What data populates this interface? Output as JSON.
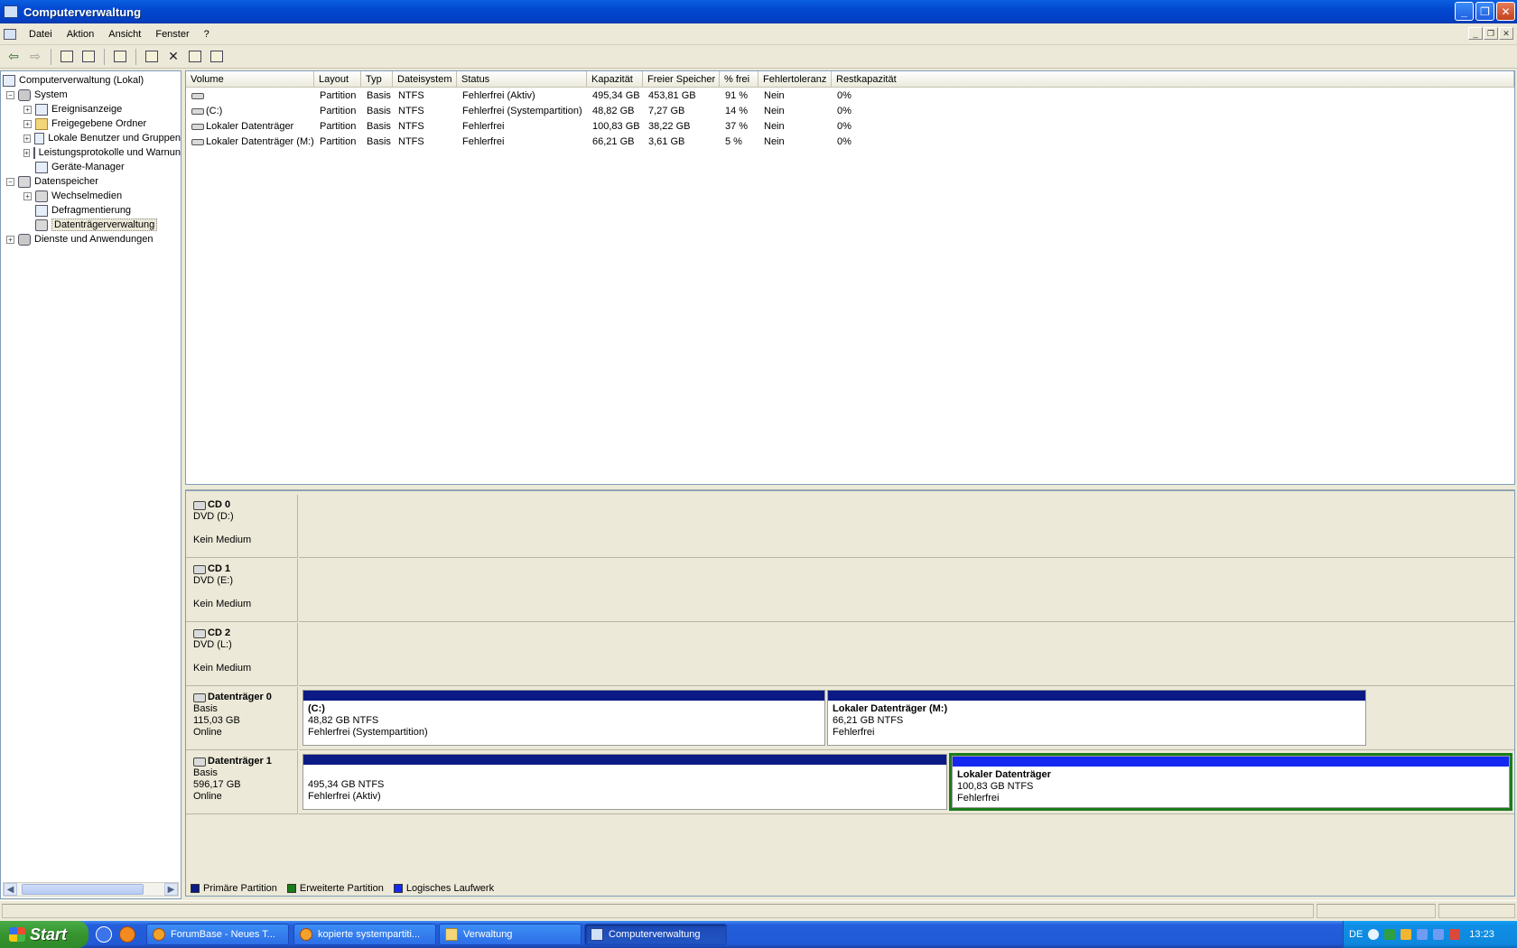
{
  "window": {
    "title": "Computerverwaltung",
    "buttons": {
      "minimize": "_",
      "maximize": "❐",
      "close": "✕"
    }
  },
  "menu": [
    "Datei",
    "Aktion",
    "Ansicht",
    "Fenster",
    "?"
  ],
  "tree": {
    "items": [
      {
        "label": "Computerverwaltung (Lokal)",
        "icon": "computer-icon",
        "level": 0,
        "expander": ""
      },
      {
        "label": "System",
        "icon": "tools-icon",
        "level": 1,
        "expander": "−"
      },
      {
        "label": "Ereignisanzeige",
        "icon": "event-viewer-icon",
        "level": 2,
        "expander": "+"
      },
      {
        "label": "Freigegebene Ordner",
        "icon": "shared-folder-icon",
        "level": 2,
        "expander": "+"
      },
      {
        "label": "Lokale Benutzer und Gruppen",
        "icon": "users-icon",
        "level": 2,
        "expander": "+"
      },
      {
        "label": "Leistungsprotokolle und Warnungen",
        "icon": "performance-log-icon",
        "level": 2,
        "expander": "+"
      },
      {
        "label": "Geräte-Manager",
        "icon": "device-manager-icon",
        "level": 2,
        "expander": ""
      },
      {
        "label": "Datenspeicher",
        "icon": "storage-icon",
        "level": 1,
        "expander": "−"
      },
      {
        "label": "Wechselmedien",
        "icon": "removable-media-icon",
        "level": 2,
        "expander": "+"
      },
      {
        "label": "Defragmentierung",
        "icon": "defrag-icon",
        "level": 2,
        "expander": ""
      },
      {
        "label": "Datenträgerverwaltung",
        "icon": "disk-management-icon",
        "level": 2,
        "expander": "",
        "selected": true
      },
      {
        "label": "Dienste und Anwendungen",
        "icon": "services-icon",
        "level": 1,
        "expander": "+"
      }
    ]
  },
  "volume_table": {
    "columns": [
      "Volume",
      "Layout",
      "Typ",
      "Dateisystem",
      "Status",
      "Kapazität",
      "Freier Speicher",
      "% frei",
      "Fehlertoleranz",
      "Restkapazität"
    ],
    "rows": [
      [
        "",
        "Partition",
        "Basis",
        "NTFS",
        "Fehlerfrei (Aktiv)",
        "495,34 GB",
        "453,81 GB",
        "91 %",
        "Nein",
        "0%"
      ],
      [
        " (C:)",
        "Partition",
        "Basis",
        "NTFS",
        "Fehlerfrei (Systempartition)",
        "48,82 GB",
        "7,27 GB",
        "14 %",
        "Nein",
        "0%"
      ],
      [
        "Lokaler Datenträger",
        "Partition",
        "Basis",
        "NTFS",
        "Fehlerfrei",
        "100,83 GB",
        "38,22 GB",
        "37 %",
        "Nein",
        "0%"
      ],
      [
        "Lokaler Datenträger (M:)",
        "Partition",
        "Basis",
        "NTFS",
        "Fehlerfrei",
        "66,21 GB",
        "3,61 GB",
        "5 %",
        "Nein",
        "0%"
      ]
    ]
  },
  "disks": [
    {
      "name": "CD 0",
      "line1": "DVD (D:)",
      "line2": "",
      "line3": "Kein Medium",
      "partitions": []
    },
    {
      "name": "CD 1",
      "line1": "DVD (E:)",
      "line2": "",
      "line3": "Kein Medium",
      "partitions": []
    },
    {
      "name": "CD 2",
      "line1": "DVD (L:)",
      "line2": "",
      "line3": "Kein Medium",
      "partitions": []
    },
    {
      "name": "Datenträger 0",
      "line1": "Basis",
      "line2": "115,03 GB",
      "line3": "Online",
      "partitions": [
        {
          "title": " (C:)",
          "size": "48,82 GB NTFS",
          "status": "Fehlerfrei (Systempartition)",
          "kind": "primary"
        },
        {
          "title": "Lokaler Datenträger  (M:)",
          "size": "66,21 GB NTFS",
          "status": "Fehlerfrei",
          "kind": "primary"
        }
      ]
    },
    {
      "name": "Datenträger 1",
      "line1": "Basis",
      "line2": "596,17 GB",
      "line3": "Online",
      "partitions": [
        {
          "title": "",
          "size": "495,34 GB NTFS",
          "status": "Fehlerfrei (Aktiv)",
          "kind": "primary"
        },
        {
          "title": "Lokaler Datenträger",
          "size": "100,83 GB NTFS",
          "status": "Fehlerfrei",
          "kind": "logical"
        }
      ]
    }
  ],
  "legend": [
    {
      "label": "Primäre Partition",
      "color": "#0b1a84"
    },
    {
      "label": "Erweiterte Partition",
      "color": "#1b7b1b"
    },
    {
      "label": "Logisches Laufwerk",
      "color": "#1428f0"
    }
  ],
  "taskbar": {
    "start": "Start",
    "tasks": [
      {
        "label": "ForumBase - Neues T...",
        "icon": "firefox-icon"
      },
      {
        "label": "kopierte systempartiti...",
        "icon": "firefox-icon"
      },
      {
        "label": "Verwaltung",
        "icon": "folder-icon"
      },
      {
        "label": "Computerverwaltung",
        "icon": "computer-management-icon",
        "active": true
      }
    ],
    "tray": {
      "language": "DE",
      "clock": "13:23"
    }
  },
  "colors": {
    "primary_partition": "#0b1a84",
    "extended_partition": "#1b7b1b",
    "logical_drive": "#1428f0"
  }
}
